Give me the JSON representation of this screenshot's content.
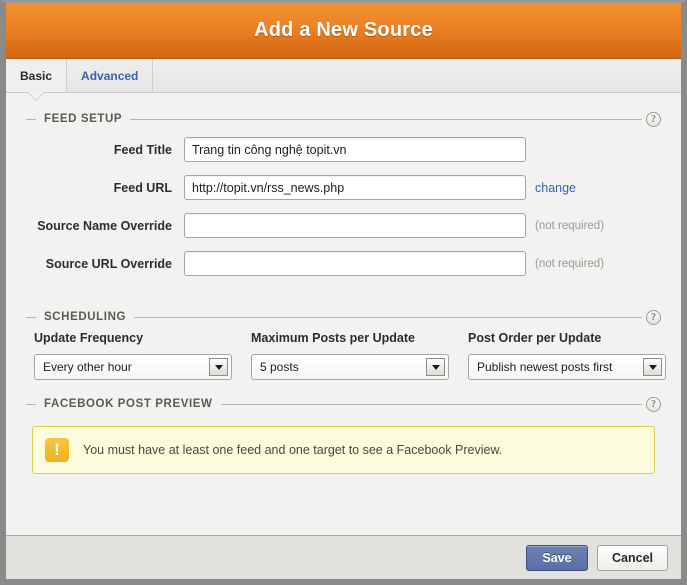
{
  "dialog": {
    "title": "Add a New Source"
  },
  "tabs": [
    {
      "label": "Basic",
      "active": true
    },
    {
      "label": "Advanced",
      "active": false
    }
  ],
  "sections": {
    "feed_setup": {
      "legend": "FEED SETUP",
      "help_glyph": "?",
      "fields": [
        {
          "label": "Feed Title",
          "value": "Trang tin công nghệ topit.vn",
          "placeholder": "",
          "hint": ""
        },
        {
          "label": "Feed URL",
          "value": "http://topit.vn/rss_news.php",
          "placeholder": "",
          "hint": "",
          "link": "change"
        },
        {
          "label": "Source Name Override",
          "value": "",
          "placeholder": "",
          "hint": "(not required)"
        },
        {
          "label": "Source URL Override",
          "value": "",
          "placeholder": "",
          "hint": "(not required)"
        }
      ]
    },
    "scheduling": {
      "legend": "SCHEDULING",
      "help_glyph": "?",
      "columns": [
        {
          "label": "Update Frequency",
          "value": "Every other hour"
        },
        {
          "label": "Maximum Posts per Update",
          "value": "5 posts"
        },
        {
          "label": "Post Order per Update",
          "value": "Publish newest posts first"
        }
      ]
    },
    "facebook_preview": {
      "legend": "FACEBOOK POST PREVIEW",
      "help_glyph": "?",
      "warning": {
        "icon_glyph": "!",
        "message": "You must have at least one feed and one target to see a Facebook Preview."
      }
    }
  },
  "footer": {
    "save_label": "Save",
    "cancel_label": "Cancel"
  },
  "colors": {
    "titlebar_orange": "#ec8226",
    "tab_link_blue": "#3c62a8",
    "save_button_blue": "#5a6fa5",
    "warning_bg": "#fcfbdc",
    "warning_border": "#d9cd53",
    "warning_icon": "#eeb21e"
  }
}
